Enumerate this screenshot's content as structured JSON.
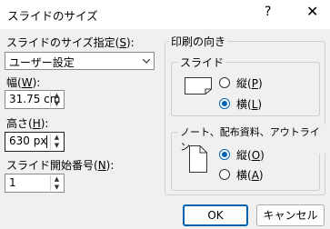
{
  "window": {
    "title": "スライドのサイズ",
    "help_glyph": "?",
    "close_glyph": "✕"
  },
  "size": {
    "label": "スライドのサイズ指定(",
    "accel": "S",
    "tail": "):",
    "value": "ユーザー設定"
  },
  "width": {
    "label": "幅(",
    "accel": "W",
    "tail": "):",
    "value": "31.75 cm"
  },
  "height": {
    "label": "高さ(",
    "accel": "H",
    "tail": "):",
    "value": "630 px"
  },
  "number": {
    "label": "スライド開始番号(",
    "accel": "N",
    "tail": "):",
    "value": "1"
  },
  "orientation": {
    "title": "印刷の向き",
    "slide": {
      "title": "スライド",
      "portrait": {
        "label": "縦(",
        "accel": "P",
        "tail": ")",
        "checked": false
      },
      "landscape": {
        "label": "横(",
        "accel": "L",
        "tail": ")",
        "checked": true
      }
    },
    "notes": {
      "title": "ノート、配布資料、アウトライン",
      "portrait": {
        "label": "縦(",
        "accel": "O",
        "tail": ")",
        "checked": true
      },
      "landscape": {
        "label": "横(",
        "accel": "A",
        "tail": ")",
        "checked": false
      }
    }
  },
  "buttons": {
    "ok": "OK",
    "cancel": "キャンセル"
  },
  "colors": {
    "accent": "#0063b1"
  }
}
